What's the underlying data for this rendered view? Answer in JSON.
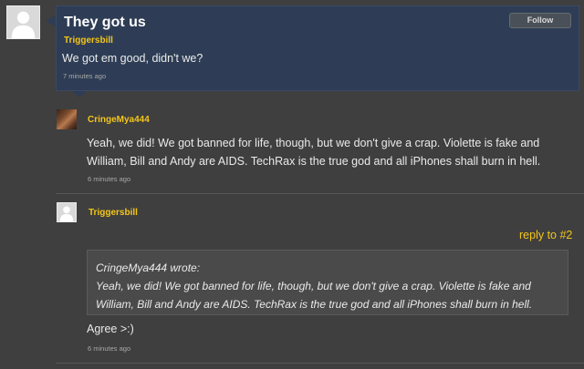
{
  "topic": {
    "title": "They got us",
    "follow_label": "Follow",
    "author": "Triggersbill",
    "message": "We got em good, didn't we?",
    "time": "7 minutes ago"
  },
  "replies": [
    {
      "author": "CringeMya444",
      "message": "Yeah, we did! We got banned for life, though, but we don't give a crap. Violette is fake and William, Bill and Andy are AIDS. TechRax is the true god and all iPhones shall burn in hell.",
      "time": "6 minutes ago"
    },
    {
      "author": "Triggersbill",
      "reply_to": "reply to #2",
      "quote": {
        "header": "CringeMya444 wrote:",
        "text": "Yeah, we did! We got banned for life, though, but we don't give a crap. Violette is fake and William, Bill and Andy are AIDS. TechRax is the true god and all iPhones shall burn in hell."
      },
      "message": "Agree >:)",
      "time": "6 minutes ago"
    }
  ],
  "colors": {
    "background": "#3f3f3f",
    "topic_bg": "#2e3d55",
    "author": "#f4c51a"
  }
}
